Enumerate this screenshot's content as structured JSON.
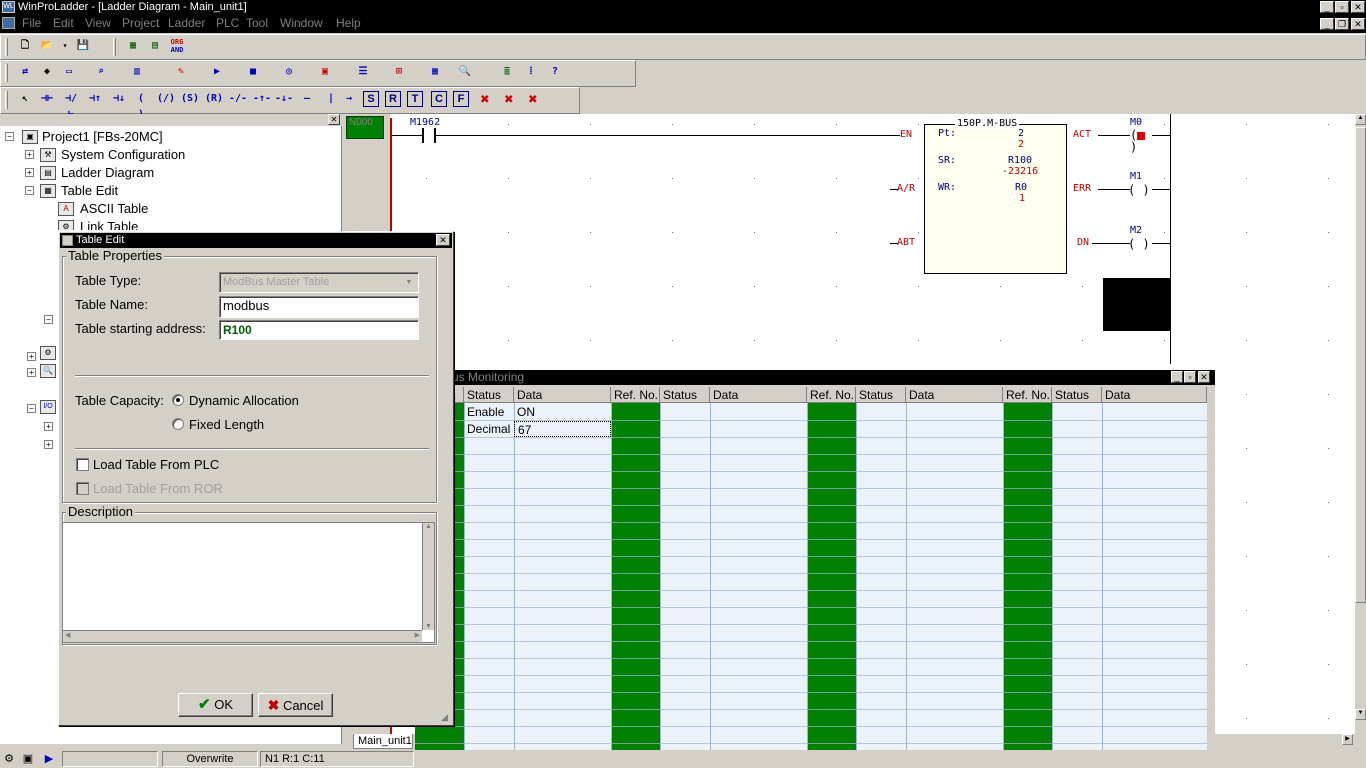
{
  "window": {
    "title": "WinProLadder - [Ladder Diagram - Main_unit1]"
  },
  "menu": [
    "File",
    "Edit",
    "View",
    "Project",
    "Ladder",
    "PLC",
    "Tool",
    "Window",
    "Help"
  ],
  "toolbar": {
    "org_and_line1": "ORG",
    "org_and_line2": "AND"
  },
  "tree": {
    "root": "Project1 [FBs-20MC]",
    "items": [
      "System Configuration",
      "Ladder Diagram",
      "Table Edit",
      "ASCII Table",
      "Link Table"
    ]
  },
  "ladder": {
    "row_badge": "N000",
    "contact": "M1962",
    "fb_name": "150P.M-BUS",
    "pins_left": [
      "EN",
      "A/R",
      "ABT"
    ],
    "pins_right": [
      "ACT",
      "ERR",
      "DN"
    ],
    "params": [
      {
        "label": "Pt:",
        "v1": "2",
        "v2": "2"
      },
      {
        "label": "SR:",
        "v1": "R100",
        "v2": "-23216"
      },
      {
        "label": "WR:",
        "v1": "R0",
        "v2": "1"
      }
    ],
    "coils": [
      "M0",
      "M1",
      "M2"
    ],
    "coil_symbol": "( )"
  },
  "dialog": {
    "title": "Table Edit",
    "group_props": "Table Properties",
    "type_label": "Table Type:",
    "type_value": "ModBus Master Table",
    "name_label": "Table Name:",
    "name_value": "modbus",
    "addr_label": "Table starting address:",
    "addr_value": "R100",
    "capacity_label": "Table Capacity:",
    "opt_dynamic": "Dynamic Allocation",
    "opt_fixed": "Fixed Length",
    "load_plc": "Load Table From PLC",
    "load_ror": "Load Table From ROR",
    "desc_label": "Description",
    "ok": "OK",
    "cancel": "Cancel"
  },
  "monitor": {
    "title": "us Monitoring",
    "headers": {
      "ref": "Ref. No.",
      "status": "Status",
      "data": "Data"
    },
    "header_first_ref": ".",
    "rows": [
      {
        "status": "Enable",
        "data": "ON"
      },
      {
        "status": "Decimal",
        "data": "67"
      }
    ]
  },
  "tab": "Main_unit1",
  "statusbar": {
    "mode": "Overwrite",
    "pos": "N1 R:1 C:11"
  },
  "colors": {
    "green": "#008000",
    "titlebar": "#000000",
    "dialog": "#d4d0c8"
  }
}
